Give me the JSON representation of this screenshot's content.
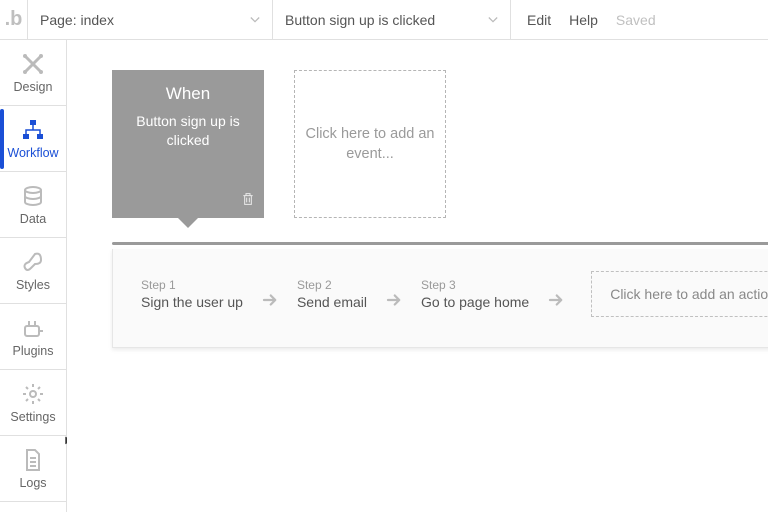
{
  "topbar": {
    "page_dropdown_label": "Page: index",
    "event_dropdown_label": "Button sign up is clicked",
    "edit": "Edit",
    "help": "Help",
    "saved": "Saved"
  },
  "sidebar": {
    "items": [
      {
        "label": "Design"
      },
      {
        "label": "Workflow"
      },
      {
        "label": "Data"
      },
      {
        "label": "Styles"
      },
      {
        "label": "Plugins"
      },
      {
        "label": "Settings"
      },
      {
        "label": "Logs"
      }
    ]
  },
  "event": {
    "when": "When",
    "condition": "Button sign up is clicked"
  },
  "add_event_text": "Click here to add an event...",
  "steps": [
    {
      "num": "Step 1",
      "name": "Sign the user up"
    },
    {
      "num": "Step 2",
      "name": "Send email"
    },
    {
      "num": "Step 3",
      "name": "Go to page home"
    }
  ],
  "add_action_text": "Click here to add an action..."
}
